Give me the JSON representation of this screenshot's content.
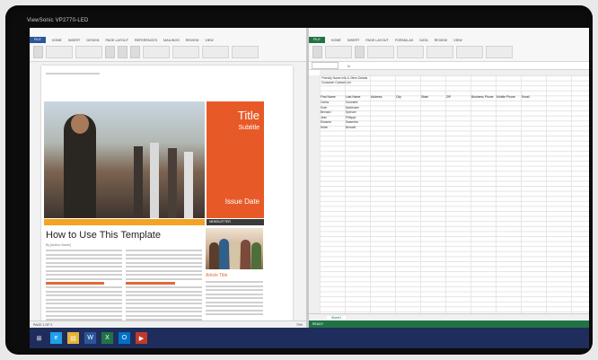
{
  "monitor": {
    "brand": "ViewSonic VP2770-LED"
  },
  "word": {
    "window_title": "",
    "tabs": [
      "FILE",
      "HOME",
      "INSERT",
      "DESIGN",
      "PAGE LAYOUT",
      "REFERENCES",
      "MAILINGS",
      "REVIEW",
      "VIEW"
    ],
    "title": "Title",
    "subtitle": "Subtitle",
    "issue_date": "Issue Date",
    "heading": "How to Use This Template",
    "author": "By [Author Name]",
    "sub_heading_1": "Adding your own content",
    "article_title": "Article Title",
    "sub_heading_2": "Replacing pictures",
    "caption_bar": "NEWSLETTER",
    "status": [
      "PAGE 1 OF 2",
      "",
      "",
      ""
    ],
    "zoom": "70%"
  },
  "excel": {
    "window_title": "",
    "tabs": [
      "FILE",
      "HOME",
      "INSERT",
      "PAGE LAYOUT",
      "FORMULAS",
      "DATA",
      "REVIEW",
      "VIEW"
    ],
    "name_box": "",
    "sheet_info": [
      "Friendly Name Info & Other Details",
      "Customer Contact List"
    ],
    "columns": [
      "First Name",
      "Last Name",
      "Address",
      "City",
      "State",
      "ZIP",
      "Business Phone",
      "Mobile Phone",
      "Email"
    ],
    "rows": [
      [
        "Carlos",
        "Gonzalez",
        "",
        "",
        "",
        "",
        "",
        "",
        ""
      ],
      [
        "Sven",
        "Mortensen",
        "",
        "",
        "",
        "",
        "",
        "",
        ""
      ],
      [
        "Bernard",
        "Spencer",
        "",
        "",
        "",
        "",
        "",
        "",
        ""
      ],
      [
        "Jean",
        "Philippe",
        "",
        "",
        "",
        "",
        "",
        "",
        ""
      ],
      [
        "Eduardo",
        "Saavedra",
        "",
        "",
        "",
        "",
        "",
        "",
        ""
      ],
      [
        "Helen",
        "Bennett",
        "",
        "",
        "",
        "",
        "",
        "",
        ""
      ],
      [
        "",
        "",
        "",
        "",
        "",
        "",
        "",
        "",
        ""
      ],
      [
        "",
        "",
        "",
        "",
        "",
        "",
        "",
        "",
        ""
      ],
      [
        "",
        "",
        "",
        "",
        "",
        "",
        "",
        "",
        ""
      ],
      [
        "",
        "",
        "",
        "",
        "",
        "",
        "",
        "",
        ""
      ],
      [
        "",
        "",
        "",
        "",
        "",
        "",
        "",
        "",
        ""
      ],
      [
        "",
        "",
        "",
        "",
        "",
        "",
        "",
        "",
        ""
      ],
      [
        "",
        "",
        "",
        "",
        "",
        "",
        "",
        "",
        ""
      ],
      [
        "",
        "",
        "",
        "",
        "",
        "",
        "",
        "",
        ""
      ],
      [
        "",
        "",
        "",
        "",
        "",
        "",
        "",
        "",
        ""
      ],
      [
        "",
        "",
        "",
        "",
        "",
        "",
        "",
        "",
        ""
      ],
      [
        "",
        "",
        "",
        "",
        "",
        "",
        "",
        "",
        ""
      ],
      [
        "",
        "",
        "",
        "",
        "",
        "",
        "",
        "",
        ""
      ],
      [
        "",
        "",
        "",
        "",
        "",
        "",
        "",
        "",
        ""
      ],
      [
        "",
        "",
        "",
        "",
        "",
        "",
        "",
        "",
        ""
      ],
      [
        "",
        "",
        "",
        "",
        "",
        "",
        "",
        "",
        ""
      ],
      [
        "",
        "",
        "",
        "",
        "",
        "",
        "",
        "",
        ""
      ],
      [
        "",
        "",
        "",
        "",
        "",
        "",
        "",
        "",
        ""
      ],
      [
        "",
        "",
        "",
        "",
        "",
        "",
        "",
        "",
        ""
      ],
      [
        "",
        "",
        "",
        "",
        "",
        "",
        "",
        "",
        ""
      ],
      [
        "",
        "",
        "",
        "",
        "",
        "",
        "",
        "",
        ""
      ],
      [
        "",
        "",
        "",
        "",
        "",
        "",
        "",
        "",
        ""
      ],
      [
        "",
        "",
        "",
        "",
        "",
        "",
        "",
        "",
        ""
      ],
      [
        "",
        "",
        "",
        "",
        "",
        "",
        "",
        "",
        ""
      ],
      [
        "",
        "",
        "",
        "",
        "",
        "",
        "",
        "",
        ""
      ],
      [
        "",
        "",
        "",
        "",
        "",
        "",
        "",
        "",
        ""
      ],
      [
        "",
        "",
        "",
        "",
        "",
        "",
        "",
        "",
        ""
      ],
      [
        "",
        "",
        "",
        "",
        "",
        "",
        "",
        "",
        ""
      ],
      [
        "",
        "",
        "",
        "",
        "",
        "",
        "",
        "",
        ""
      ],
      [
        "",
        "",
        "",
        "",
        "",
        "",
        "",
        "",
        ""
      ],
      [
        "",
        "",
        "",
        "",
        "",
        "",
        "",
        "",
        ""
      ],
      [
        "",
        "",
        "",
        "",
        "",
        "",
        "",
        "",
        ""
      ],
      [
        "",
        "",
        "",
        "",
        "",
        "",
        "",
        "",
        ""
      ],
      [
        "",
        "",
        "",
        "",
        "",
        "",
        "",
        "",
        ""
      ],
      [
        "",
        "",
        "",
        "",
        "",
        "",
        "",
        "",
        ""
      ],
      [
        "",
        "",
        "",
        "",
        "",
        "",
        "",
        "",
        ""
      ]
    ],
    "sheet_tab": "Sheet1",
    "status": [
      "READY"
    ]
  },
  "taskbar": {
    "icons": [
      "windows-logo-icon",
      "ie-icon",
      "explorer-icon",
      "word-icon",
      "excel-icon",
      "outlook-icon",
      "media-icon"
    ],
    "glyphs": [
      "⊞",
      "e",
      "▤",
      "W",
      "X",
      "O",
      "▶"
    ],
    "colors": [
      "#1f2d5c",
      "#1ea1e8",
      "#e8b23a",
      "#2b579a",
      "#217346",
      "#0072c6",
      "#c1392b"
    ],
    "time": "",
    "date": ""
  },
  "colors": {
    "word_accent": "#2b579a",
    "excel_accent": "#217346",
    "newsletter_orange": "#e75a28",
    "band_yellow": "#f3a325"
  }
}
